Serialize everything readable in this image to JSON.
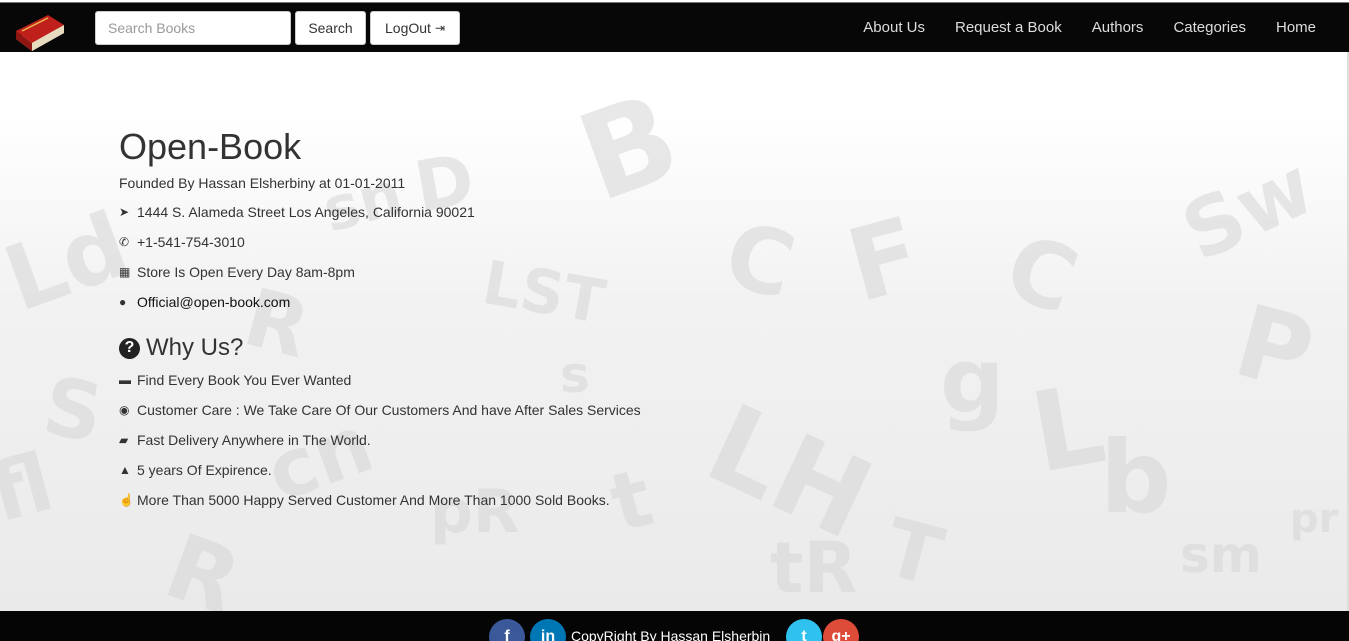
{
  "header": {
    "search_placeholder": "Search Books",
    "search_label": "Search",
    "logout_label": "LogOut",
    "nav": [
      "About Us",
      "Request a Book",
      "Authors",
      "Categories",
      "Home"
    ]
  },
  "about": {
    "title": "Open-Book",
    "founded": "Founded By Hassan Elsherbiny at 01-01-2011",
    "address": "1444 S. Alameda Street Los Angeles, California 90021",
    "phone": "+1-541-754-3010",
    "hours": "Store Is Open Every Day 8am-8pm",
    "email": "Official@open-book.com"
  },
  "why": {
    "heading": "Why Us?",
    "items": [
      "Find Every Book You Ever Wanted",
      "Customer Care : We Take Care Of Our Customers And have After Sales Services",
      "Fast Delivery Anywhere in The World.",
      "5 years Of Expirence.",
      "More Than 5000 Happy Served Customer And More Than 1000 Sold Books."
    ]
  },
  "footer": {
    "copyright": "CopyRight By Hassan Elsherbin"
  }
}
